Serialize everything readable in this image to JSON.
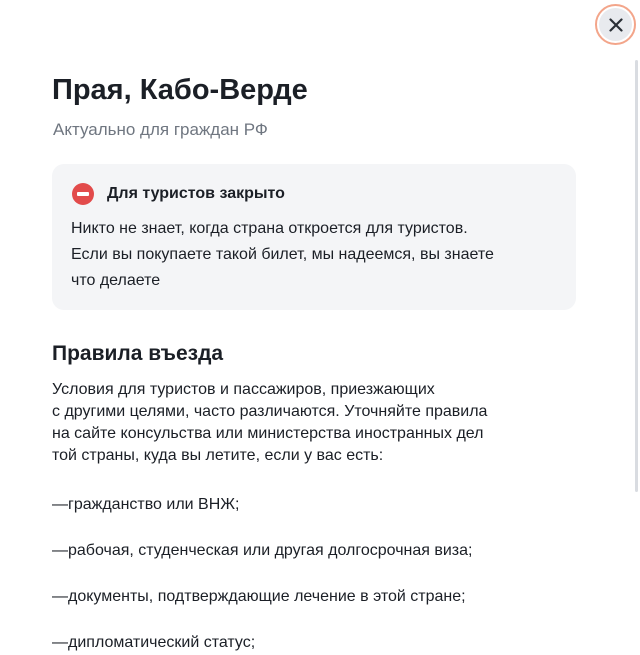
{
  "header": {
    "close_icon": "close-icon"
  },
  "title": "Прая, Кабо-Верде",
  "subtitle": "Актуально для граждан РФ",
  "notice": {
    "icon": "no-entry-icon",
    "icon_color": "#e24b4b",
    "title": "Для туристов закрыто",
    "lines": [
      "Никто не знает, когда страна откроется для туристов.",
      "Если вы покупаете такой билет, мы надеемся, вы знаете",
      "что делаете"
    ]
  },
  "rules": {
    "title": "Правила въезда",
    "lines": [
      "Условия для туристов и пассажиров, приезжающих",
      "с другими целями, часто различаются. Уточняйте правила",
      "на сайте консульства или министерства иностранных дел",
      "той страны, куда вы летите, если у вас есть:"
    ],
    "items": [
      {
        "dash": "—",
        "text": "гражданство или ВНЖ;"
      },
      {
        "dash": "—",
        "text": "рабочая, студенческая или другая долгосрочная виза;"
      },
      {
        "dash": "—",
        "text": "документы, подтверждающие лечение в этой стране;"
      },
      {
        "dash": "—",
        "text": "дипломатический статус;"
      }
    ]
  },
  "colors": {
    "close_border": "#f3a58a",
    "close_fill": "#e8eaee",
    "notice_bg": "#f4f5f7",
    "subtitle": "#6f7680"
  }
}
